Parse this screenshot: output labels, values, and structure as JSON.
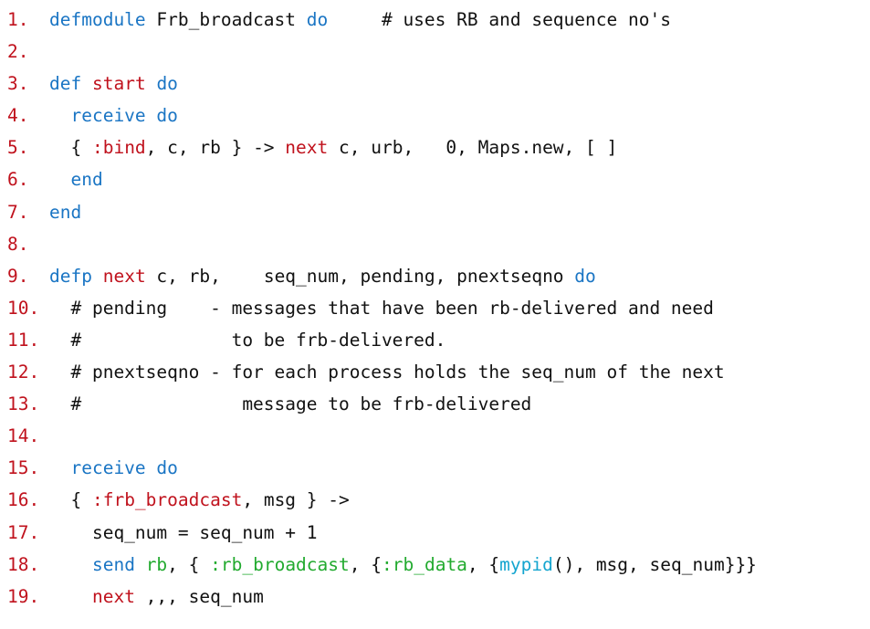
{
  "colors": {
    "line_number": "#c0121d",
    "keyword": "#1a75c4",
    "function_name": "#c0121d",
    "green_identifier": "#22aa2f",
    "cyan_identifier": "#14a5cf",
    "text": "#111111"
  },
  "code": {
    "lines": [
      {
        "num": "1.",
        "segments": [
          {
            "text": "defmodule",
            "style": "kw"
          },
          {
            "text": " Frb_broadcast ",
            "style": "tx"
          },
          {
            "text": "do",
            "style": "kw"
          },
          {
            "text": "     # uses RB and sequence no's",
            "style": "tx"
          }
        ]
      },
      {
        "num": "2.",
        "segments": []
      },
      {
        "num": "3.",
        "segments": [
          {
            "text": "def",
            "style": "kw"
          },
          {
            "text": " ",
            "style": "tx"
          },
          {
            "text": "start",
            "style": "fn"
          },
          {
            "text": " ",
            "style": "tx"
          },
          {
            "text": "do",
            "style": "kw"
          }
        ]
      },
      {
        "num": "4.",
        "segments": [
          {
            "text": "  ",
            "style": "tx"
          },
          {
            "text": "receive",
            "style": "kw"
          },
          {
            "text": " ",
            "style": "tx"
          },
          {
            "text": "do",
            "style": "kw"
          }
        ]
      },
      {
        "num": "5.",
        "segments": [
          {
            "text": "  { ",
            "style": "tx"
          },
          {
            "text": ":bind",
            "style": "fn"
          },
          {
            "text": ", c, rb } -> ",
            "style": "tx"
          },
          {
            "text": "next",
            "style": "fn"
          },
          {
            "text": " c, urb,   0, Maps.new, [ ]",
            "style": "tx"
          }
        ]
      },
      {
        "num": "6.",
        "segments": [
          {
            "text": "  ",
            "style": "tx"
          },
          {
            "text": "end",
            "style": "kw"
          }
        ]
      },
      {
        "num": "7.",
        "segments": [
          {
            "text": "end",
            "style": "kw"
          }
        ]
      },
      {
        "num": "8.",
        "segments": []
      },
      {
        "num": "9.",
        "segments": [
          {
            "text": "defp",
            "style": "kw"
          },
          {
            "text": " ",
            "style": "tx"
          },
          {
            "text": "next",
            "style": "fn"
          },
          {
            "text": " c, rb,    seq_num, pending, pnextseqno ",
            "style": "tx"
          },
          {
            "text": "do",
            "style": "kw"
          }
        ]
      },
      {
        "num": "10.",
        "segments": [
          {
            "text": "  # pending    - messages that have been rb-delivered and need",
            "style": "tx"
          }
        ]
      },
      {
        "num": "11.",
        "segments": [
          {
            "text": "  #              to be frb-delivered.",
            "style": "tx"
          }
        ]
      },
      {
        "num": "12.",
        "segments": [
          {
            "text": "  # pnextseqno - for each process holds the seq_num of the next",
            "style": "tx"
          }
        ]
      },
      {
        "num": "13.",
        "segments": [
          {
            "text": "  #               message to be frb-delivered",
            "style": "tx"
          }
        ]
      },
      {
        "num": "14.",
        "segments": []
      },
      {
        "num": "15.",
        "segments": [
          {
            "text": "  ",
            "style": "tx"
          },
          {
            "text": "receive",
            "style": "kw"
          },
          {
            "text": " ",
            "style": "tx"
          },
          {
            "text": "do",
            "style": "kw"
          }
        ]
      },
      {
        "num": "16.",
        "segments": [
          {
            "text": "  { ",
            "style": "tx"
          },
          {
            "text": ":frb_broadcast",
            "style": "fn"
          },
          {
            "text": ", msg } ->",
            "style": "tx"
          }
        ]
      },
      {
        "num": "17.",
        "segments": [
          {
            "text": "    seq_num = seq_num + 1",
            "style": "tx"
          }
        ]
      },
      {
        "num": "18.",
        "segments": [
          {
            "text": "    ",
            "style": "tx"
          },
          {
            "text": "send",
            "style": "kw"
          },
          {
            "text": " ",
            "style": "tx"
          },
          {
            "text": "rb",
            "style": "gr"
          },
          {
            "text": ", { ",
            "style": "tx"
          },
          {
            "text": ":rb_broadcast",
            "style": "gr"
          },
          {
            "text": ", {",
            "style": "tx"
          },
          {
            "text": ":rb_data",
            "style": "gr"
          },
          {
            "text": ", {",
            "style": "tx"
          },
          {
            "text": "mypid",
            "style": "cy"
          },
          {
            "text": "(), msg, seq_num}}}",
            "style": "tx"
          }
        ]
      },
      {
        "num": "19.",
        "segments": [
          {
            "text": "    ",
            "style": "tx"
          },
          {
            "text": "next",
            "style": "fn"
          },
          {
            "text": " ,,, seq_num",
            "style": "tx"
          }
        ]
      }
    ]
  }
}
